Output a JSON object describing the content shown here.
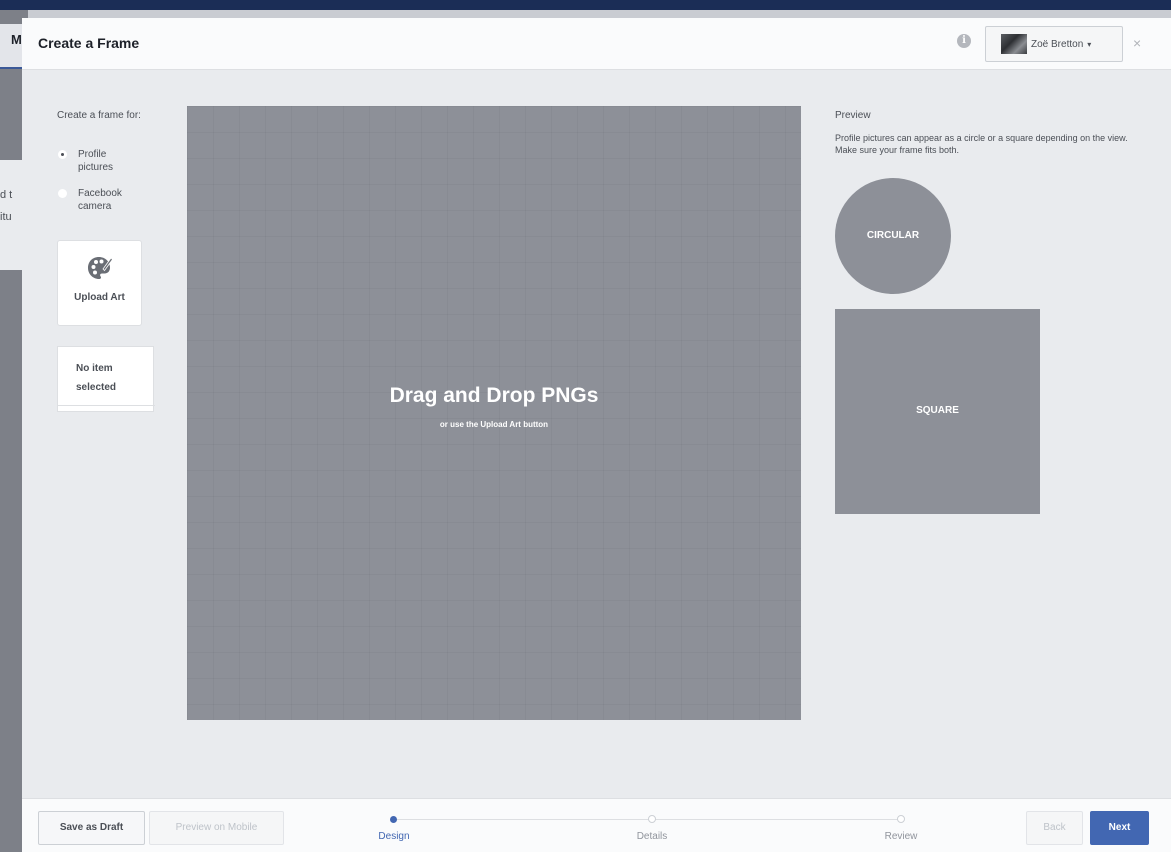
{
  "background": {
    "tab_label": "M",
    "snippets": [
      "d t",
      "itu"
    ]
  },
  "header": {
    "title": "Create a Frame",
    "info_icon": "info-icon",
    "account": {
      "name": "Zoë Bretton",
      "caret": "▾"
    },
    "close": "×"
  },
  "sidebar": {
    "frame_for": "Create a frame for:",
    "options": [
      {
        "label": "Profile pictures",
        "selected": true
      },
      {
        "label": "Facebook camera",
        "selected": false
      }
    ],
    "upload_label": "Upload Art",
    "upload_icon": "palette-icon",
    "no_item": "No item selected"
  },
  "canvas": {
    "title": "Drag and Drop PNGs",
    "subtitle": "or use the Upload Art button"
  },
  "preview": {
    "title": "Preview",
    "description": "Profile pictures can appear as a circle or a square depending on the view. Make sure your frame fits both.",
    "circle_label": "CIRCULAR",
    "square_label": "SQUARE"
  },
  "footer": {
    "save_draft": "Save as Draft",
    "preview_mobile": "Preview on Mobile",
    "steps": [
      {
        "label": "Design",
        "active": true
      },
      {
        "label": "Details",
        "active": false
      },
      {
        "label": "Review",
        "active": false
      }
    ],
    "back": "Back",
    "next": "Next"
  },
  "colors": {
    "accent": "#4267b2",
    "canvas": "#8d9098",
    "modal_bg": "#e9ebee"
  }
}
